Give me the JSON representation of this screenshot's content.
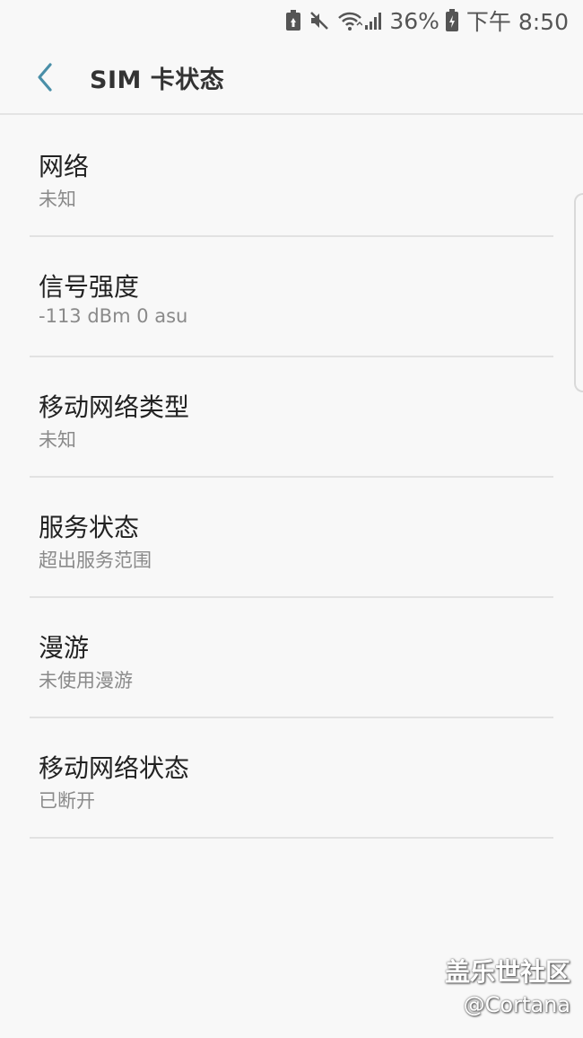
{
  "status_bar": {
    "battery_percent": "36%",
    "time": "下午 8:50"
  },
  "header": {
    "title": "SIM 卡状态"
  },
  "items": [
    {
      "title": "网络",
      "value": "未知"
    },
    {
      "title": "信号强度",
      "value": "-113 dBm 0 asu"
    },
    {
      "title": "移动网络类型",
      "value": "未知"
    },
    {
      "title": "服务状态",
      "value": "超出服务范围"
    },
    {
      "title": "漫游",
      "value": "未使用漫游"
    },
    {
      "title": "移动网络状态",
      "value": "已断开"
    }
  ],
  "watermark": {
    "site": "盖乐世社区",
    "user": "@Cortana"
  },
  "colors": {
    "accent": "#4a8fa8",
    "background": "#f8f8f8"
  }
}
